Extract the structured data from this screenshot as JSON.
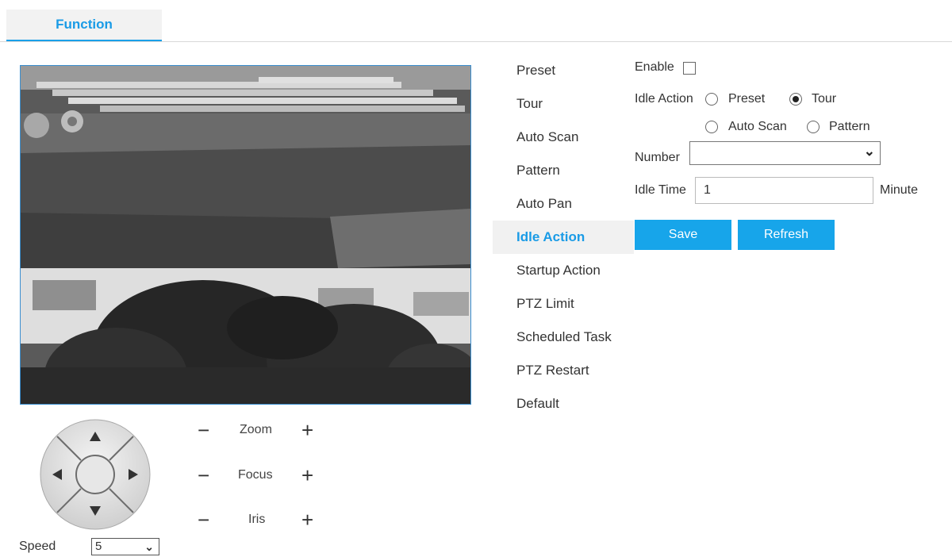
{
  "header": {
    "tab_label": "Function"
  },
  "ptz": {
    "zoom_label": "Zoom",
    "focus_label": "Focus",
    "iris_label": "Iris",
    "minus": "−",
    "plus": "+",
    "speed_label": "Speed",
    "speed_value": "5"
  },
  "menu": {
    "items": [
      {
        "label": "Preset"
      },
      {
        "label": "Tour"
      },
      {
        "label": "Auto Scan"
      },
      {
        "label": "Pattern"
      },
      {
        "label": "Auto Pan"
      },
      {
        "label": "Idle Action"
      },
      {
        "label": "Startup Action"
      },
      {
        "label": "PTZ Limit"
      },
      {
        "label": "Scheduled Task"
      },
      {
        "label": "PTZ Restart"
      },
      {
        "label": "Default"
      }
    ],
    "active": "Idle Action"
  },
  "form": {
    "enable_label": "Enable",
    "enable_checked": false,
    "idle_action_label": "Idle Action",
    "options": {
      "preset": "Preset",
      "tour": "Tour",
      "auto_scan": "Auto Scan",
      "pattern": "Pattern"
    },
    "selected_option": "Tour",
    "number_label": "Number",
    "number_value": "",
    "idle_time_label": "Idle Time",
    "idle_time_value": "1",
    "idle_time_unit": "Minute",
    "save_label": "Save",
    "refresh_label": "Refresh"
  },
  "colors": {
    "accent": "#1a9be6",
    "button": "#17a5ea",
    "video_border": "#3b8fd0"
  },
  "icons": [
    "up-arrow-icon",
    "down-arrow-icon",
    "left-arrow-icon",
    "right-arrow-icon",
    "chevron-down-icon"
  ]
}
